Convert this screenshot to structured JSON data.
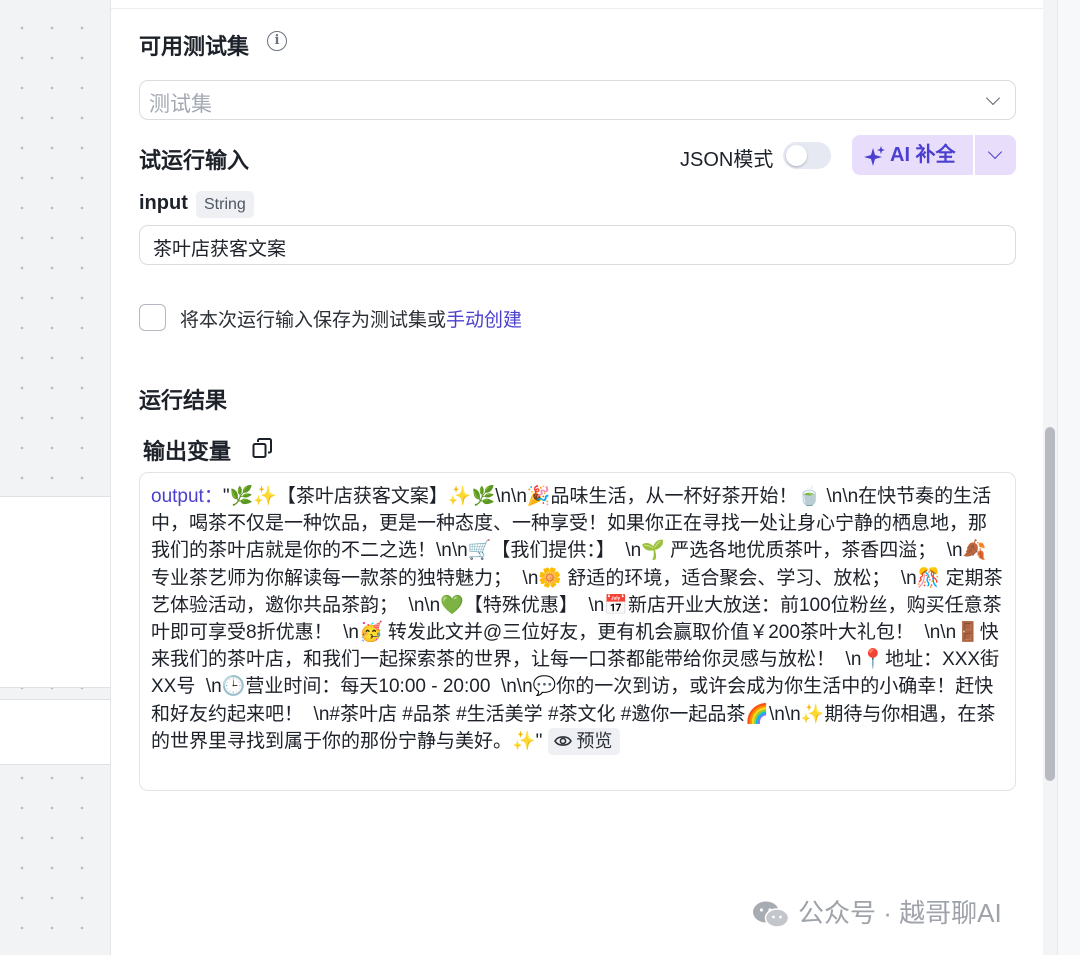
{
  "testset": {
    "title": "可用测试集",
    "placeholder": "测试集"
  },
  "trial_input": {
    "title": "试运行输入",
    "json_mode_label": "JSON模式",
    "json_mode_on": false,
    "ai_button_label": "AI 补全",
    "field_name": "input",
    "field_type": "String",
    "field_value": "茶叶店获客文案",
    "save_prefix": "将本次运行输入保存为测试集或",
    "save_link": "手动创建"
  },
  "result": {
    "title": "运行结果",
    "output_var_label": "输出变量",
    "output_key": "output：",
    "output_value": "\"🌿✨【茶叶店获客文案】✨🌿\\n\\n🎉品味生活，从一杯好茶开始！🍵 \\n\\n在快节奏的生活中，喝茶不仅是一种饮品，更是一种态度、一种享受！如果你正在寻找一处让身心宁静的栖息地，那我们的茶叶店就是你的不二之选！\\n\\n🛒【我们提供：】  \\n🌱 严选各地优质茶叶，茶香四溢；  \\n🍂 专业茶艺师为你解读每一款茶的独特魅力；  \\n🌼 舒适的环境，适合聚会、学习、放松；  \\n🎊 定期茶艺体验活动，邀你共品茶韵；  \\n\\n💚【特殊优惠】  \\n📅新店开业大放送：前100位粉丝，购买任意茶叶即可享受8折优惠！  \\n🥳 转发此文并@三位好友，更有机会赢取价值￥200茶叶大礼包！  \\n\\n🚪快来我们的茶叶店，和我们一起探索茶的世界，让每一口茶都能带给你灵感与放松！  \\n📍地址：XXX街XX号  \\n🕒营业时间：每天10:00 - 20:00  \\n\\n💬你的一次到访，或许会成为你生活中的小确幸！赶快和好友约起来吧！  \\n#茶叶店 #品茶 #生活美学 #茶文化 #邀你一起品茶🌈\\n\\n✨期待与你相遇，在茶的世界里寻找到属于你的那份宁静与美好。✨\"",
    "preview_label": "预览"
  },
  "watermark": "公众号 · 越哥聊AI",
  "icons": [
    "info-icon",
    "chevron-down-icon",
    "sparkle-icon",
    "copy-icon",
    "eye-icon",
    "wechat-icon"
  ],
  "colors": {
    "accent": "#4b3fcf",
    "ai_button_bg": "#e8ddfb"
  }
}
